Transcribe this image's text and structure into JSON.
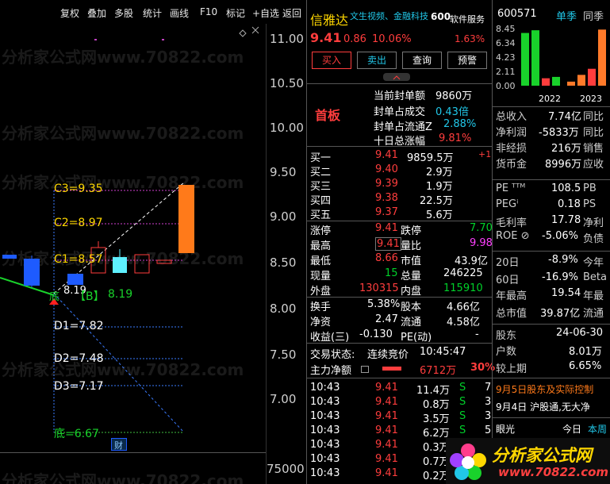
{
  "toolbar": [
    "复权",
    "叠加",
    "多股",
    "统计",
    "画线",
    "F10",
    "标记",
    "+自选",
    "返回"
  ],
  "axis_labels": [
    "11.00",
    "10.50",
    "10.00",
    "9.50",
    "9.00",
    "8.50",
    "8.00",
    "7.50",
    "7.00",
    "75000"
  ],
  "chart": {
    "levels": [
      {
        "label": "C3=9.35",
        "color": "#ff40ff"
      },
      {
        "label": "C2=8.97",
        "color": "#ff40ff"
      },
      {
        "label": "C1=8.57",
        "color": "#ff40ff"
      },
      {
        "label": "D1=7.82",
        "color": "#3a7bff"
      },
      {
        "label": "D2=7.48",
        "color": "#3a7bff"
      },
      {
        "label": "D3=7.17",
        "color": "#3a7bff"
      }
    ],
    "bottom_label": "底=6.67",
    "buy_tag": "【B】",
    "buy_value": "8.19",
    "low_tag": "8.19",
    "mid_char": "底",
    "cai_label": "财",
    "watermark": "分析家公式网www.70822.com"
  },
  "quote": {
    "name": "信雅达",
    "concepts": "文生视频、金融科技",
    "concept_num": "600",
    "ad": "软件服务",
    "price": "9.41",
    "change": "0.86",
    "change_pct": "10.06%",
    "ratio": "1.63%",
    "buttons": [
      "买入",
      "卖出",
      "查询",
      "预警"
    ],
    "tag": "首板",
    "seal_stats": [
      {
        "label": "当前封单额",
        "value": "9860万"
      },
      {
        "label": "封单占成交",
        "value": "0.43倍"
      },
      {
        "label": "封单占流通Z",
        "value": "2.88%"
      },
      {
        "label": "十日总涨幅",
        "value": "9.81%"
      }
    ],
    "book": [
      {
        "label": "买一",
        "price": "9.41",
        "vol": "9859.5万",
        "extra": "+1"
      },
      {
        "label": "买二",
        "price": "9.40",
        "vol": "2.9万",
        "extra": ""
      },
      {
        "label": "买三",
        "price": "9.39",
        "vol": "1.9万",
        "extra": ""
      },
      {
        "label": "买四",
        "price": "9.38",
        "vol": "22.5万",
        "extra": ""
      },
      {
        "label": "买五",
        "price": "9.37",
        "vol": "5.6万",
        "extra": ""
      }
    ],
    "stats": [
      {
        "l1": "涨停",
        "v1": "9.41",
        "l2": "跌停",
        "v2": "7.70"
      },
      {
        "l1": "最高",
        "v1": "9.41",
        "l2": "量比",
        "v2": "9.98"
      },
      {
        "l1": "最低",
        "v1": "8.66",
        "l2": "市值",
        "v2": "43.9亿"
      },
      {
        "l1": "现量",
        "v1": "15",
        "l2": "总量",
        "v2": "246225"
      },
      {
        "l1": "外盘",
        "v1": "130315",
        "l2": "内盘",
        "v2": "115910"
      }
    ],
    "stats2": [
      {
        "l1": "换手",
        "v1": "5.38%",
        "l2": "股本",
        "v2": "4.66亿"
      },
      {
        "l1": "净资",
        "v1": "2.47",
        "l2": "流通",
        "v2": "4.58亿"
      },
      {
        "l1": "收益(三)",
        "v1": "-0.130",
        "l2": "PE(动)",
        "v2": "-"
      }
    ],
    "trade_status_label": "交易状态:",
    "trade_status": "连续竞价",
    "trade_time": "10:45:47",
    "main_net_label": "主力净额",
    "main_net": "6712万",
    "main_net_pct": "30%",
    "ticks": [
      {
        "time": "10:43",
        "price": "9.41",
        "vol": "11.4万",
        "bs": "S",
        "n": "7"
      },
      {
        "time": "10:43",
        "price": "9.41",
        "vol": "0.8万",
        "bs": "S",
        "n": "3"
      },
      {
        "time": "10:43",
        "price": "9.41",
        "vol": "3.5万",
        "bs": "S",
        "n": "3"
      },
      {
        "time": "10:43",
        "price": "9.41",
        "vol": "6.2万",
        "bs": "S",
        "n": "5"
      },
      {
        "time": "10:43",
        "price": "9.41",
        "vol": "0.3万",
        "bs": "",
        "n": ""
      },
      {
        "time": "10:43",
        "price": "9.41",
        "vol": "0.7万",
        "bs": "",
        "n": ""
      },
      {
        "time": "10:43",
        "price": "9.41",
        "vol": "0.2万",
        "bs": "",
        "n": ""
      }
    ]
  },
  "right": {
    "code": "600571",
    "tab1": "单季",
    "tab2": "同季",
    "bar_labels": [
      "2022",
      "2023"
    ],
    "ylabels": [
      "8.45",
      "6.34",
      "4.23",
      "2.11",
      "0.00"
    ],
    "bars": [
      {
        "value": 7.8,
        "color": "#19d22b"
      },
      {
        "value": 8.2,
        "color": "#19d22b"
      },
      {
        "value": 1.1,
        "color": "#ff3d3d"
      },
      {
        "value": 1.3,
        "color": "#19d22b"
      },
      {
        "value": 0.6,
        "color": "#ff7a2a"
      },
      {
        "value": 1.6,
        "color": "#ff7a2a"
      },
      {
        "value": 2.5,
        "color": "#ff3d3d"
      },
      {
        "value": 8.3,
        "color": "#ff7a2a"
      }
    ],
    "fin": [
      {
        "l": "总收入",
        "v": "7.74亿",
        "t": "同比"
      },
      {
        "l": "净利润",
        "v": "-5833万",
        "t": "同比"
      },
      {
        "l": "非经损",
        "v": "216万",
        "t": "销售"
      },
      {
        "l": "货币金",
        "v": "8996万",
        "t": "应收"
      }
    ],
    "fin2": [
      {
        "l": "PE ᵀᵀᴹ",
        "v": "108.5",
        "t": "PB"
      },
      {
        "l": "PEGⁱ",
        "v": "0.18",
        "t": "PS"
      },
      {
        "l": "毛利率",
        "v": "17.78",
        "t": "净利"
      },
      {
        "l": "ROE ⊘",
        "v": "-5.06%",
        "t": "负债"
      }
    ],
    "fin3": [
      {
        "l": "20日",
        "v": "-8.9%",
        "t": "今年"
      },
      {
        "l": "60日",
        "v": "-16.9%",
        "t": "Beta"
      },
      {
        "l": "年最高",
        "v": "19.54",
        "t": "年最"
      },
      {
        "l": "总市值",
        "v": "39.87亿",
        "t": "流通"
      }
    ],
    "fin4": [
      {
        "l": "股东",
        "v": "24-06-30"
      },
      {
        "l": "户数",
        "v": "8.01万"
      },
      {
        "l": "较上期",
        "v": "6.65%"
      }
    ],
    "news1": "9月5日股东及实际控制",
    "news2": "9月4日 沪股通,无大净",
    "footer_left": "眼光",
    "footer_right1": "今日",
    "footer_right2": "本周",
    "logo_text": "分析家公式网",
    "logo_url": "www.70822.com"
  }
}
